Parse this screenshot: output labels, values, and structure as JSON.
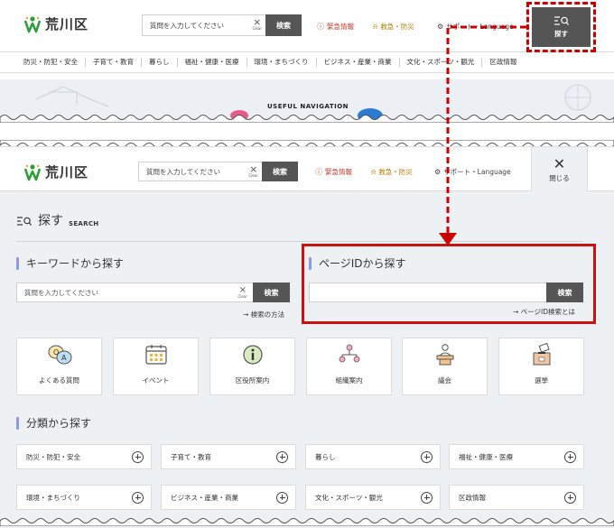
{
  "header": {
    "logo_text": "荒川区",
    "search_placeholder": "質問を入力してください",
    "clear_label": "Clear",
    "search_button": "検索",
    "emergency": "緊急情報",
    "rescue": "救急・防災",
    "support": "サポート・Language",
    "explore_label": "探す",
    "close_label": "閉じる"
  },
  "nav": {
    "items": [
      "防災・防犯・安全",
      "子育て・教育",
      "暮らし",
      "福祉・健康・医療",
      "環境・まちづくり",
      "ビジネス・産業・商業",
      "文化・スポーツ・観光",
      "区政情報"
    ]
  },
  "hero": {
    "useful": "USEFUL NAVIGATION"
  },
  "panel": {
    "title": "探す",
    "title_en": "SEARCH",
    "keyword": {
      "heading": "キーワードから探す",
      "placeholder": "質問を入力してください",
      "clear_label": "Clear",
      "button": "検索",
      "help_link": "→ 検索の方法"
    },
    "pageid": {
      "heading": "ページIDから探す",
      "button": "検索",
      "help_link": "→ ページID検索とは"
    },
    "tiles": [
      "よくある質問",
      "イベント",
      "区役所案内",
      "組織案内",
      "議会",
      "選挙"
    ],
    "category": {
      "heading": "分類から探す",
      "items": [
        "防災・防犯・安全",
        "子育て・教育",
        "暮らし",
        "福祉・健康・医療",
        "環境・まちづくり",
        "ビジネス・産業・商業",
        "文化・スポーツ・観光",
        "区政情報"
      ]
    }
  },
  "colors": {
    "accent_dark": "#555555",
    "highlight_red": "#cc1111",
    "panel_bg": "#eef1f3",
    "brand_green": "#2e9e3a"
  }
}
